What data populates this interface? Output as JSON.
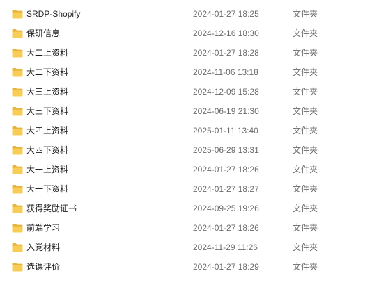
{
  "folder_icon": "folder-icon",
  "folder_color": "#F5C542",
  "files": [
    {
      "name": "SRDP-Shopify",
      "modified": "2024-01-27 18:25",
      "type": "文件夹"
    },
    {
      "name": "保研信息",
      "modified": "2024-12-16 18:30",
      "type": "文件夹"
    },
    {
      "name": "大二上资料",
      "modified": "2024-01-27 18:28",
      "type": "文件夹"
    },
    {
      "name": "大二下资料",
      "modified": "2024-11-06 13:18",
      "type": "文件夹"
    },
    {
      "name": "大三上资料",
      "modified": "2024-12-09 15:28",
      "type": "文件夹"
    },
    {
      "name": "大三下资料",
      "modified": "2024-06-19 21:30",
      "type": "文件夹"
    },
    {
      "name": "大四上资料",
      "modified": "2025-01-11 13:40",
      "type": "文件夹"
    },
    {
      "name": "大四下资料",
      "modified": "2025-06-29 13:31",
      "type": "文件夹"
    },
    {
      "name": "大一上资料",
      "modified": "2024-01-27 18:26",
      "type": "文件夹"
    },
    {
      "name": "大一下资料",
      "modified": "2024-01-27 18:27",
      "type": "文件夹"
    },
    {
      "name": "获得奖励证书",
      "modified": "2024-09-25 19:26",
      "type": "文件夹"
    },
    {
      "name": "前端学习",
      "modified": "2024-01-27 18:26",
      "type": "文件夹"
    },
    {
      "name": "入党材料",
      "modified": "2024-11-29 11:26",
      "type": "文件夹"
    },
    {
      "name": "选课评价",
      "modified": "2024-01-27 18:29",
      "type": "文件夹"
    }
  ]
}
